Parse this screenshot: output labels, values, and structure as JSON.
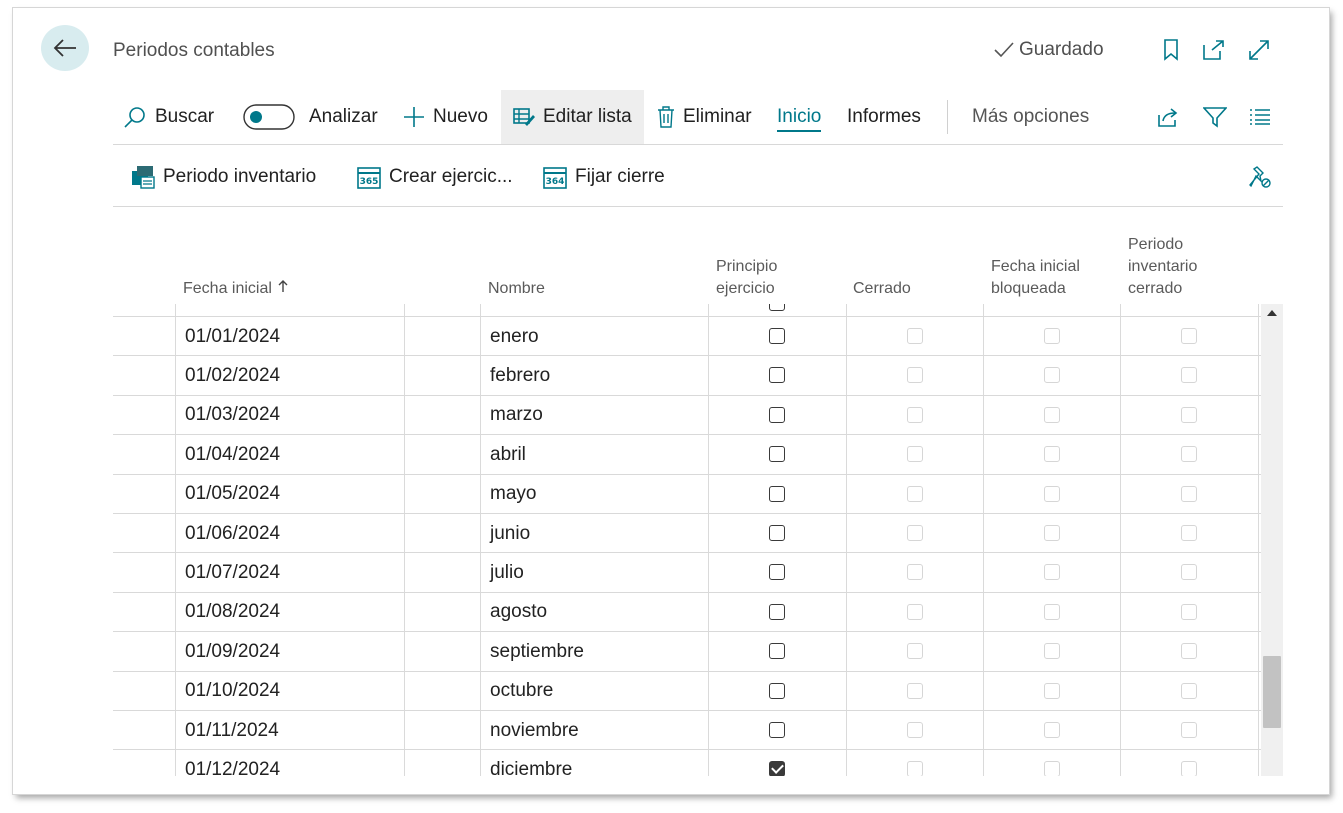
{
  "page": {
    "title": "Periodos contables",
    "status": "Guardado"
  },
  "actions": {
    "search": "Buscar",
    "analyze": "Analizar",
    "new": "Nuevo",
    "edit_list": "Editar lista",
    "delete": "Eliminar",
    "home_tab": "Inicio",
    "reports_tab": "Informes",
    "more": "Más opciones"
  },
  "subactions": {
    "inventory_period": "Periodo inventario",
    "create_fiscal_year": "Crear ejercic...",
    "close_year": "Fijar cierre"
  },
  "columns": {
    "start_date": "Fecha inicial",
    "name": "Nombre",
    "new_fiscal_year_1": "Principio",
    "new_fiscal_year_2": "ejercicio",
    "closed": "Cerrado",
    "date_locked_1": "Fecha inicial",
    "date_locked_2": "bloqueada",
    "inv_closed_1": "Periodo",
    "inv_closed_2": "inventario",
    "inv_closed_3": "cerrado"
  },
  "rows": [
    {
      "date": "01/01/2024",
      "name": "enero",
      "fiscal_start": false
    },
    {
      "date": "01/02/2024",
      "name": "febrero",
      "fiscal_start": false
    },
    {
      "date": "01/03/2024",
      "name": "marzo",
      "fiscal_start": false
    },
    {
      "date": "01/04/2024",
      "name": "abril",
      "fiscal_start": false
    },
    {
      "date": "01/05/2024",
      "name": "mayo",
      "fiscal_start": false
    },
    {
      "date": "01/06/2024",
      "name": "junio",
      "fiscal_start": false
    },
    {
      "date": "01/07/2024",
      "name": "julio",
      "fiscal_start": false
    },
    {
      "date": "01/08/2024",
      "name": "agosto",
      "fiscal_start": false
    },
    {
      "date": "01/09/2024",
      "name": "septiembre",
      "fiscal_start": false
    },
    {
      "date": "01/10/2024",
      "name": "octubre",
      "fiscal_start": false
    },
    {
      "date": "01/11/2024",
      "name": "noviembre",
      "fiscal_start": false
    },
    {
      "date": "01/12/2024",
      "name": "diciembre",
      "fiscal_start": true
    }
  ],
  "colors": {
    "accent": "#00788a",
    "back_bg": "#d8ecef"
  }
}
